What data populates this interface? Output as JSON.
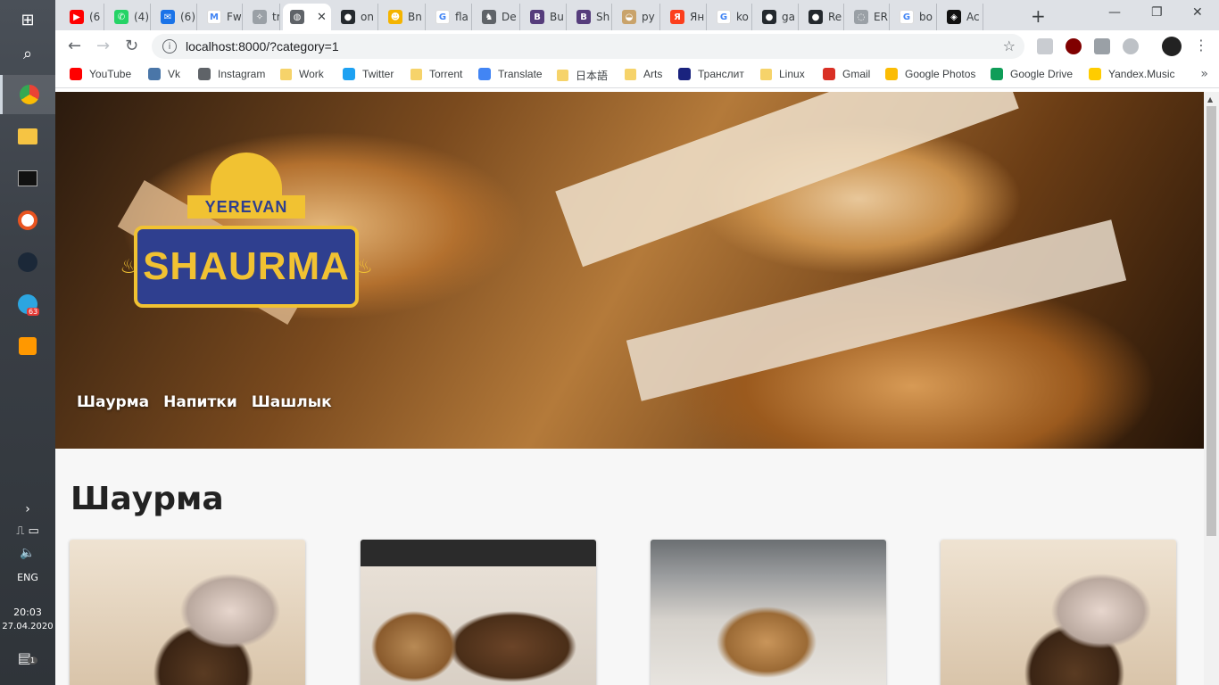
{
  "taskbar": {
    "lang": "ENG",
    "time": "20:03",
    "date": "27.04.2020",
    "telegram_badge": "63",
    "notifications_badge": "1"
  },
  "tabs": [
    {
      "label": "(6",
      "color": "#ff0000",
      "glyph": "▶"
    },
    {
      "label": "(4)",
      "color": "#25d366",
      "glyph": "✆"
    },
    {
      "label": "(6)",
      "color": "#1a73e8",
      "glyph": "✉"
    },
    {
      "label": "Fw",
      "color": "#ffffff",
      "glyph": "M"
    },
    {
      "label": "tra",
      "color": "#9aa0a6",
      "glyph": "✧"
    },
    {
      "label": "",
      "color": "#5f6368",
      "glyph": "◍"
    },
    {
      "label": "on",
      "color": "#24292e",
      "glyph": "●"
    },
    {
      "label": "Bn",
      "color": "#f4b400",
      "glyph": "☻"
    },
    {
      "label": "fla",
      "color": "#ffffff",
      "glyph": "G"
    },
    {
      "label": "De",
      "color": "#5f6368",
      "glyph": "♞"
    },
    {
      "label": "Bu",
      "color": "#563d7c",
      "glyph": "B"
    },
    {
      "label": "Sh",
      "color": "#563d7c",
      "glyph": "B"
    },
    {
      "label": "py",
      "color": "#c9a36b",
      "glyph": "◒"
    },
    {
      "label": "Ян",
      "color": "#fc3f1d",
      "glyph": "Я"
    },
    {
      "label": "ko",
      "color": "#ffffff",
      "glyph": "G"
    },
    {
      "label": "ga",
      "color": "#24292e",
      "glyph": "●"
    },
    {
      "label": "Re",
      "color": "#24292e",
      "glyph": "●"
    },
    {
      "label": "ER",
      "color": "#9aa0a6",
      "glyph": "◌"
    },
    {
      "label": "bo",
      "color": "#ffffff",
      "glyph": "G"
    },
    {
      "label": "Ac",
      "color": "#111111",
      "glyph": "◈"
    }
  ],
  "address": {
    "url": "localhost:8000/?category=1"
  },
  "bookmarks": [
    {
      "label": "YouTube",
      "kind": "icon",
      "color": "#ff0000"
    },
    {
      "label": "Vk",
      "kind": "icon",
      "color": "#4a76a8"
    },
    {
      "label": "Instagram",
      "kind": "icon",
      "color": "#5f6368"
    },
    {
      "label": "Work",
      "kind": "folder"
    },
    {
      "label": "Twitter",
      "kind": "icon",
      "color": "#1da1f2"
    },
    {
      "label": "Torrent",
      "kind": "folder"
    },
    {
      "label": "Translate",
      "kind": "icon",
      "color": "#4285f4"
    },
    {
      "label": "日本語",
      "kind": "folder"
    },
    {
      "label": "Arts",
      "kind": "folder"
    },
    {
      "label": "Транслит",
      "kind": "icon",
      "color": "#1a237e"
    },
    {
      "label": "Linux",
      "kind": "folder"
    },
    {
      "label": "Gmail",
      "kind": "icon",
      "color": "#d93025"
    },
    {
      "label": "Google Photos",
      "kind": "icon",
      "color": "#fbbc04"
    },
    {
      "label": "Google Drive",
      "kind": "icon",
      "color": "#0f9d58"
    },
    {
      "label": "Yandex.Music",
      "kind": "icon",
      "color": "#ffcc00"
    }
  ],
  "hero": {
    "logo_top": "YEREVAN",
    "logo_main": "SHAURMA",
    "nav": [
      "Шаурма",
      "Напитки",
      "Шашлык"
    ]
  },
  "main": {
    "title": "Шаурма"
  }
}
